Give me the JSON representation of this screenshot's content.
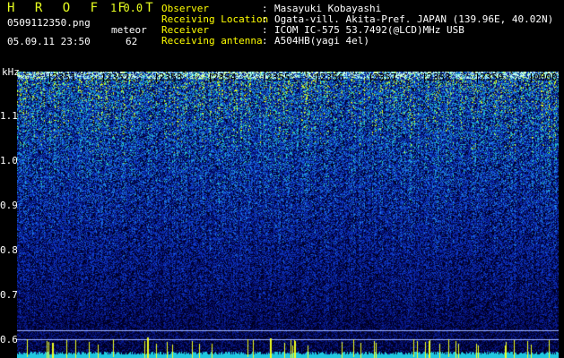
{
  "header": {
    "app_title": "H R O F F T",
    "version": "1.0.0",
    "filename": "0509112350.png",
    "meteor_label": "meteor",
    "datetime": "05.09.11 23:50",
    "meteor_count": "62"
  },
  "meta": [
    {
      "key": "Observer",
      "sep": ":",
      "value": "Masayuki Kobayashi"
    },
    {
      "key": "Receiving Location",
      "sep": ":",
      "value": "Ogata-vill. Akita-Pref. JAPAN (139.96E, 40.02N)"
    },
    {
      "key": "Receiver",
      "sep": ":",
      "value": "ICOM IC-575 53.7492(@LCD)MHz USB"
    },
    {
      "key": "Receiving antenna",
      "sep": ":",
      "value": "A504HB(yagi 4el)"
    }
  ],
  "spectrogram": {
    "y_unit": "kHz",
    "y_ticks": [
      "1.1",
      "1.0",
      "0.9",
      "0.8",
      "0.7",
      "0.6"
    ],
    "x_ticks": [
      "2351",
      "2352",
      "2353",
      "2354",
      "2355",
      "2356",
      "2357",
      "2358",
      "2359",
      "0000"
    ],
    "colors": {
      "background": "#000000",
      "low": "#0a1a8c",
      "mid": "#1f6fe0",
      "high": "#22c8c0",
      "peak": "#e8ff20",
      "label": "#ffff00"
    }
  }
}
